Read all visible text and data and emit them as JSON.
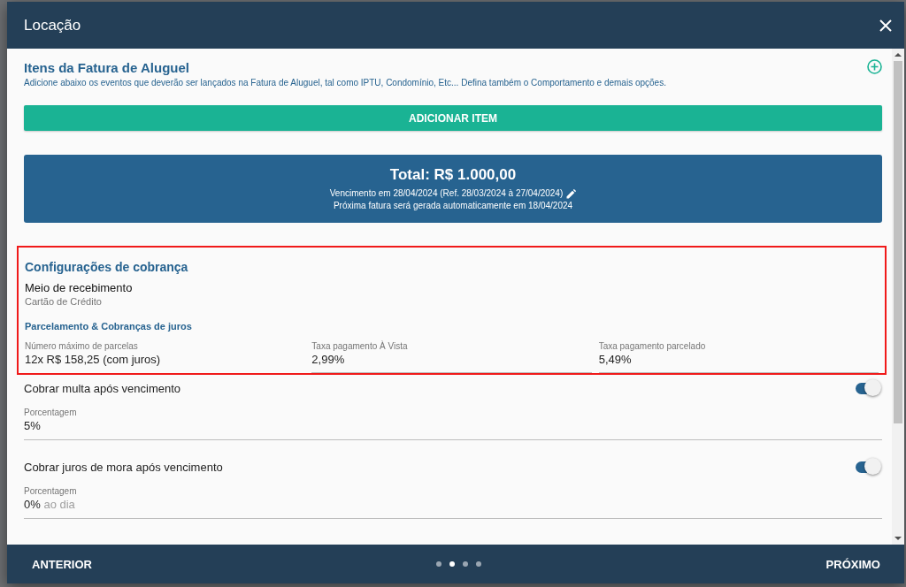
{
  "window": {
    "title": "Locação"
  },
  "invoice_items": {
    "title": "Itens da Fatura de Aluguel",
    "description": "Adicione abaixo os eventos que deverão ser lançados na Fatura de Aluguel, tal como IPTU, Condomínio, Etc... Defina também o Comportamento e demais opções.",
    "add_button": "ADICIONAR ITEM"
  },
  "total": {
    "amount": "Total: R$ 1.000,00",
    "due": "Vencimento em 28/04/2024 (Ref. 28/03/2024 à 27/04/2024)",
    "next_invoice": "Próxima fatura será gerada automaticamente em 18/04/2024"
  },
  "billing": {
    "highlighted": true,
    "title": "Configurações de cobrança",
    "method_label": "Meio de recebimento",
    "method_value": "Cartão de Crédito",
    "subtitle": "Parcelamento & Cobranças de juros",
    "fields": [
      {
        "label": "Número máximo de parcelas",
        "value": "12x R$ 158,25 (com juros)",
        "underlined": false
      },
      {
        "label": "Taxa pagamento À Vista",
        "value": "2,99%",
        "underlined": true
      },
      {
        "label": "Taxa pagamento parcelado",
        "value": "5,49%",
        "underlined": true
      }
    ]
  },
  "options": [
    {
      "label": "Cobrar multa após vencimento",
      "on": true,
      "field": {
        "label": "Porcentagem",
        "value": "5%"
      }
    },
    {
      "label": "Cobrar juros de mora após vencimento",
      "on": true,
      "field": {
        "label": "Porcentagem",
        "value": "0%",
        "suffix": "ao dia"
      }
    }
  ],
  "footer": {
    "back": "ANTERIOR",
    "next": "PRÓXIMO",
    "steps": [
      {
        "selected": false
      },
      {
        "selected": true
      },
      {
        "selected": false
      },
      {
        "selected": false
      }
    ]
  }
}
